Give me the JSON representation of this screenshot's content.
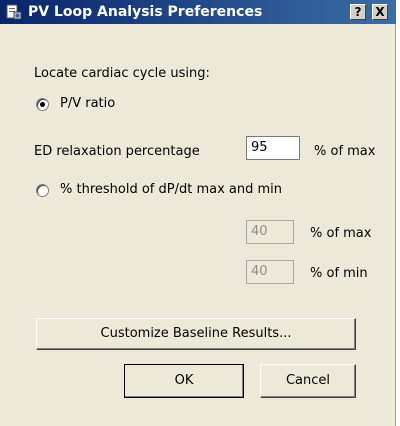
{
  "window": {
    "title": "PV Loop Analysis Preferences",
    "help_glyph": "?",
    "close_glyph": "X",
    "icon": "app-document-icon"
  },
  "locate": {
    "heading": "Locate cardiac cycle using:",
    "option_pv": {
      "label": "P/V ratio",
      "selected": true
    },
    "ed_relaxation": {
      "label": "ED relaxation percentage",
      "value": "95",
      "unit": "% of max"
    },
    "option_threshold": {
      "label": "% threshold of dP/dt max and min",
      "selected": false
    },
    "threshold_max": {
      "value": "40",
      "unit": "% of max"
    },
    "threshold_min": {
      "value": "40",
      "unit": "% of min"
    }
  },
  "buttons": {
    "customize": "Customize Baseline Results...",
    "ok": "OK",
    "cancel": "Cancel"
  },
  "colors": {
    "titlebar_start": "#0a246a",
    "titlebar_end": "#3a6ea5",
    "dialog_bg": "#ece9d8"
  }
}
